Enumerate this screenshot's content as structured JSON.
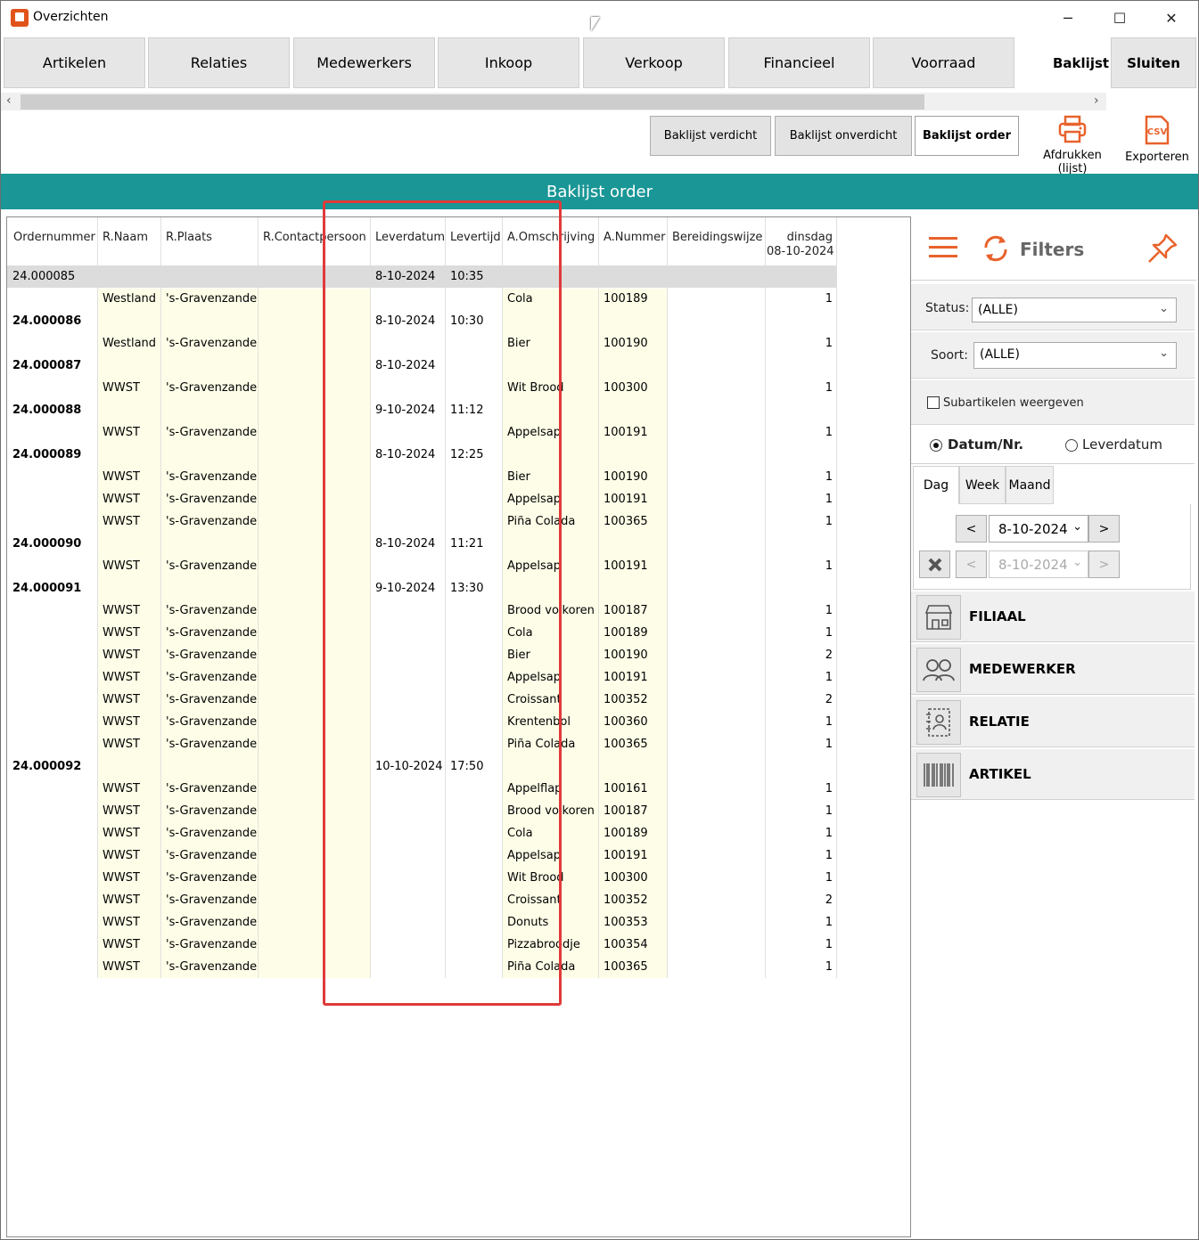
{
  "window": {
    "title": "Overzichten",
    "minimize": "─",
    "maximize": "☐",
    "close": "✕"
  },
  "tabs": [
    "Artikelen",
    "Relaties",
    "Medewerkers",
    "Inkoop",
    "Verkoop",
    "Financieel",
    "Voorraad"
  ],
  "active_tab": "Baklijst",
  "close_tab": "Sluiten",
  "toolbar": {
    "verdicht": "Baklijst verdicht",
    "onverdicht": "Baklijst onverdicht",
    "order": "Baklijst order",
    "print": "Afdrukken (lijst)",
    "export": "Exporteren",
    "export_icon_text": "CSV"
  },
  "band_title": "Baklijst order",
  "grid": {
    "headers": [
      "Ordernummer",
      "R.Naam",
      "R.Plaats",
      "R.Contactpersoon",
      "Leverdatum",
      "Levertijd",
      "A.Omschrijving",
      "A.Nummer",
      "Bereidingswijze",
      "dinsdag",
      "08-10-2024"
    ],
    "rows": [
      {
        "order": "24.000085",
        "naam": "",
        "plaats": "",
        "datum": "8-10-2024",
        "tijd": "10:35",
        "omschr": "",
        "nummer": "",
        "qty": "",
        "type": "sel"
      },
      {
        "order": "",
        "naam": "Westland",
        "plaats": "'s-Gravenzande",
        "datum": "",
        "tijd": "",
        "omschr": "Cola",
        "nummer": "100189",
        "qty": "1",
        "type": "item"
      },
      {
        "order": "24.000086",
        "naam": "",
        "plaats": "",
        "datum": "8-10-2024",
        "tijd": "10:30",
        "omschr": "",
        "nummer": "",
        "qty": "",
        "type": "order"
      },
      {
        "order": "",
        "naam": "Westland",
        "plaats": "'s-Gravenzande",
        "datum": "",
        "tijd": "",
        "omschr": "Bier",
        "nummer": "100190",
        "qty": "1",
        "type": "item"
      },
      {
        "order": "24.000087",
        "naam": "",
        "plaats": "",
        "datum": "8-10-2024",
        "tijd": "",
        "omschr": "",
        "nummer": "",
        "qty": "",
        "type": "order"
      },
      {
        "order": "",
        "naam": "WWST",
        "plaats": "'s-Gravenzande",
        "datum": "",
        "tijd": "",
        "omschr": "Wit Brood",
        "nummer": "100300",
        "qty": "1",
        "type": "item"
      },
      {
        "order": "24.000088",
        "naam": "",
        "plaats": "",
        "datum": "9-10-2024",
        "tijd": "11:12",
        "omschr": "",
        "nummer": "",
        "qty": "",
        "type": "order"
      },
      {
        "order": "",
        "naam": "WWST",
        "plaats": "'s-Gravenzande",
        "datum": "",
        "tijd": "",
        "omschr": "Appelsap",
        "nummer": "100191",
        "qty": "1",
        "type": "item"
      },
      {
        "order": "24.000089",
        "naam": "",
        "plaats": "",
        "datum": "8-10-2024",
        "tijd": "12:25",
        "omschr": "",
        "nummer": "",
        "qty": "",
        "type": "order"
      },
      {
        "order": "",
        "naam": "WWST",
        "plaats": "'s-Gravenzande",
        "datum": "",
        "tijd": "",
        "omschr": "Bier",
        "nummer": "100190",
        "qty": "1",
        "type": "item"
      },
      {
        "order": "",
        "naam": "WWST",
        "plaats": "'s-Gravenzande",
        "datum": "",
        "tijd": "",
        "omschr": "Appelsap",
        "nummer": "100191",
        "qty": "1",
        "type": "item"
      },
      {
        "order": "",
        "naam": "WWST",
        "plaats": "'s-Gravenzande",
        "datum": "",
        "tijd": "",
        "omschr": "Piña Colada",
        "nummer": "100365",
        "qty": "1",
        "type": "item"
      },
      {
        "order": "24.000090",
        "naam": "",
        "plaats": "",
        "datum": "8-10-2024",
        "tijd": "11:21",
        "omschr": "",
        "nummer": "",
        "qty": "",
        "type": "order"
      },
      {
        "order": "",
        "naam": "WWST",
        "plaats": "'s-Gravenzande",
        "datum": "",
        "tijd": "",
        "omschr": "Appelsap",
        "nummer": "100191",
        "qty": "1",
        "type": "item"
      },
      {
        "order": "24.000091",
        "naam": "",
        "plaats": "",
        "datum": "9-10-2024",
        "tijd": "13:30",
        "omschr": "",
        "nummer": "",
        "qty": "",
        "type": "order"
      },
      {
        "order": "",
        "naam": "WWST",
        "plaats": "'s-Gravenzande",
        "datum": "",
        "tijd": "",
        "omschr": "Brood volkoren",
        "nummer": "100187",
        "qty": "1",
        "type": "item"
      },
      {
        "order": "",
        "naam": "WWST",
        "plaats": "'s-Gravenzande",
        "datum": "",
        "tijd": "",
        "omschr": "Cola",
        "nummer": "100189",
        "qty": "1",
        "type": "item"
      },
      {
        "order": "",
        "naam": "WWST",
        "plaats": "'s-Gravenzande",
        "datum": "",
        "tijd": "",
        "omschr": "Bier",
        "nummer": "100190",
        "qty": "2",
        "type": "item"
      },
      {
        "order": "",
        "naam": "WWST",
        "plaats": "'s-Gravenzande",
        "datum": "",
        "tijd": "",
        "omschr": "Appelsap",
        "nummer": "100191",
        "qty": "1",
        "type": "item"
      },
      {
        "order": "",
        "naam": "WWST",
        "plaats": "'s-Gravenzande",
        "datum": "",
        "tijd": "",
        "omschr": "Croissant",
        "nummer": "100352",
        "qty": "2",
        "type": "item"
      },
      {
        "order": "",
        "naam": "WWST",
        "plaats": "'s-Gravenzande",
        "datum": "",
        "tijd": "",
        "omschr": "Krentenbol",
        "nummer": "100360",
        "qty": "1",
        "type": "item"
      },
      {
        "order": "",
        "naam": "WWST",
        "plaats": "'s-Gravenzande",
        "datum": "",
        "tijd": "",
        "omschr": "Piña Colada",
        "nummer": "100365",
        "qty": "1",
        "type": "item"
      },
      {
        "order": "24.000092",
        "naam": "",
        "plaats": "",
        "datum": "10-10-2024",
        "tijd": "17:50",
        "omschr": "",
        "nummer": "",
        "qty": "",
        "type": "order"
      },
      {
        "order": "",
        "naam": "WWST",
        "plaats": "'s-Gravenzande",
        "datum": "",
        "tijd": "",
        "omschr": "Appelflap",
        "nummer": "100161",
        "qty": "1",
        "type": "item"
      },
      {
        "order": "",
        "naam": "WWST",
        "plaats": "'s-Gravenzande",
        "datum": "",
        "tijd": "",
        "omschr": "Brood volkoren",
        "nummer": "100187",
        "qty": "1",
        "type": "item"
      },
      {
        "order": "",
        "naam": "WWST",
        "plaats": "'s-Gravenzande",
        "datum": "",
        "tijd": "",
        "omschr": "Cola",
        "nummer": "100189",
        "qty": "1",
        "type": "item"
      },
      {
        "order": "",
        "naam": "WWST",
        "plaats": "'s-Gravenzande",
        "datum": "",
        "tijd": "",
        "omschr": "Appelsap",
        "nummer": "100191",
        "qty": "1",
        "type": "item"
      },
      {
        "order": "",
        "naam": "WWST",
        "plaats": "'s-Gravenzande",
        "datum": "",
        "tijd": "",
        "omschr": "Wit Brood",
        "nummer": "100300",
        "qty": "1",
        "type": "item"
      },
      {
        "order": "",
        "naam": "WWST",
        "plaats": "'s-Gravenzande",
        "datum": "",
        "tijd": "",
        "omschr": "Croissant",
        "nummer": "100352",
        "qty": "2",
        "type": "item"
      },
      {
        "order": "",
        "naam": "WWST",
        "plaats": "'s-Gravenzande",
        "datum": "",
        "tijd": "",
        "omschr": "Donuts",
        "nummer": "100353",
        "qty": "1",
        "type": "item"
      },
      {
        "order": "",
        "naam": "WWST",
        "plaats": "'s-Gravenzande",
        "datum": "",
        "tijd": "",
        "omschr": "Pizzabroodje",
        "nummer": "100354",
        "qty": "1",
        "type": "item"
      },
      {
        "order": "",
        "naam": "WWST",
        "plaats": "'s-Gravenzande",
        "datum": "",
        "tijd": "",
        "omschr": "Piña Colada",
        "nummer": "100365",
        "qty": "1",
        "type": "item"
      }
    ]
  },
  "filters": {
    "title": "Filters",
    "status_label": "Status:",
    "status_value": "(ALLE)",
    "soort_label": "Soort:",
    "soort_value": "(ALLE)",
    "subartikelen": "Subartikelen weergeven",
    "radio_datum": "Datum/Nr.",
    "radio_leverdatum": "Leverdatum",
    "period_tabs": [
      "Dag",
      "Week",
      "Maand"
    ],
    "date_from": "8-10-2024",
    "date_to": "8-10-2024",
    "prev": "<",
    "next": ">",
    "categories": [
      "FILIAAL",
      "MEDEWERKER",
      "RELATIE",
      "ARTIKEL"
    ]
  },
  "colors": {
    "accent": "#1a9696",
    "orange": "#e8622c",
    "highlight": "#e03a3a",
    "column_shade": "#fefee8"
  }
}
